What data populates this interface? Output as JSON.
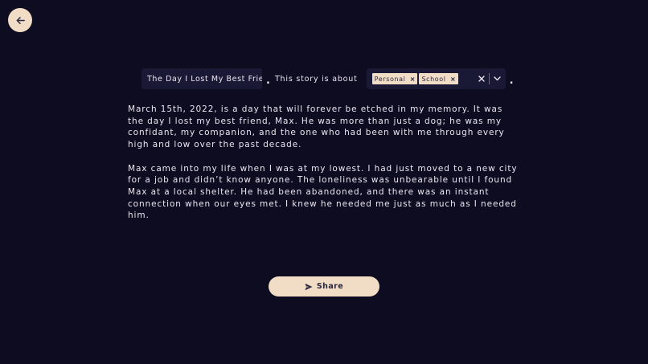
{
  "title_input": {
    "value": "The Day I Lost My Best Frier"
  },
  "header": {
    "separator": ".",
    "about_label": "This story is about",
    "trailing_dot": "."
  },
  "tags": [
    {
      "label": "Personal",
      "remove": "×"
    },
    {
      "label": "School",
      "remove": "×"
    }
  ],
  "story": {
    "paragraphs": [
      "March 15th, 2022, is a day that will forever be etched in my memory. It was the day I lost my best friend, Max. He was more than just a dog; he was my confidant, my companion, and the one who had been with me through every high and low over the past decade.",
      "Max came into my life when I was at my lowest. I had just moved to a new city for a job and didn’t know anyone. The loneliness was unbearable until I found Max at a local shelter. He had been abandoned, and there was an instant connection when our eyes met. I knew he needed me just as much as I needed him."
    ]
  },
  "share_button": {
    "label": "Share"
  },
  "icons": {
    "back": "arrow-left-icon",
    "clear": "close-icon",
    "dropdown": "chevron-down-icon",
    "share": "send-icon"
  },
  "colors": {
    "background": "#0e0c20",
    "field": "#1a1935",
    "accent": "#f1dcc5",
    "text": "#ece6f2"
  }
}
